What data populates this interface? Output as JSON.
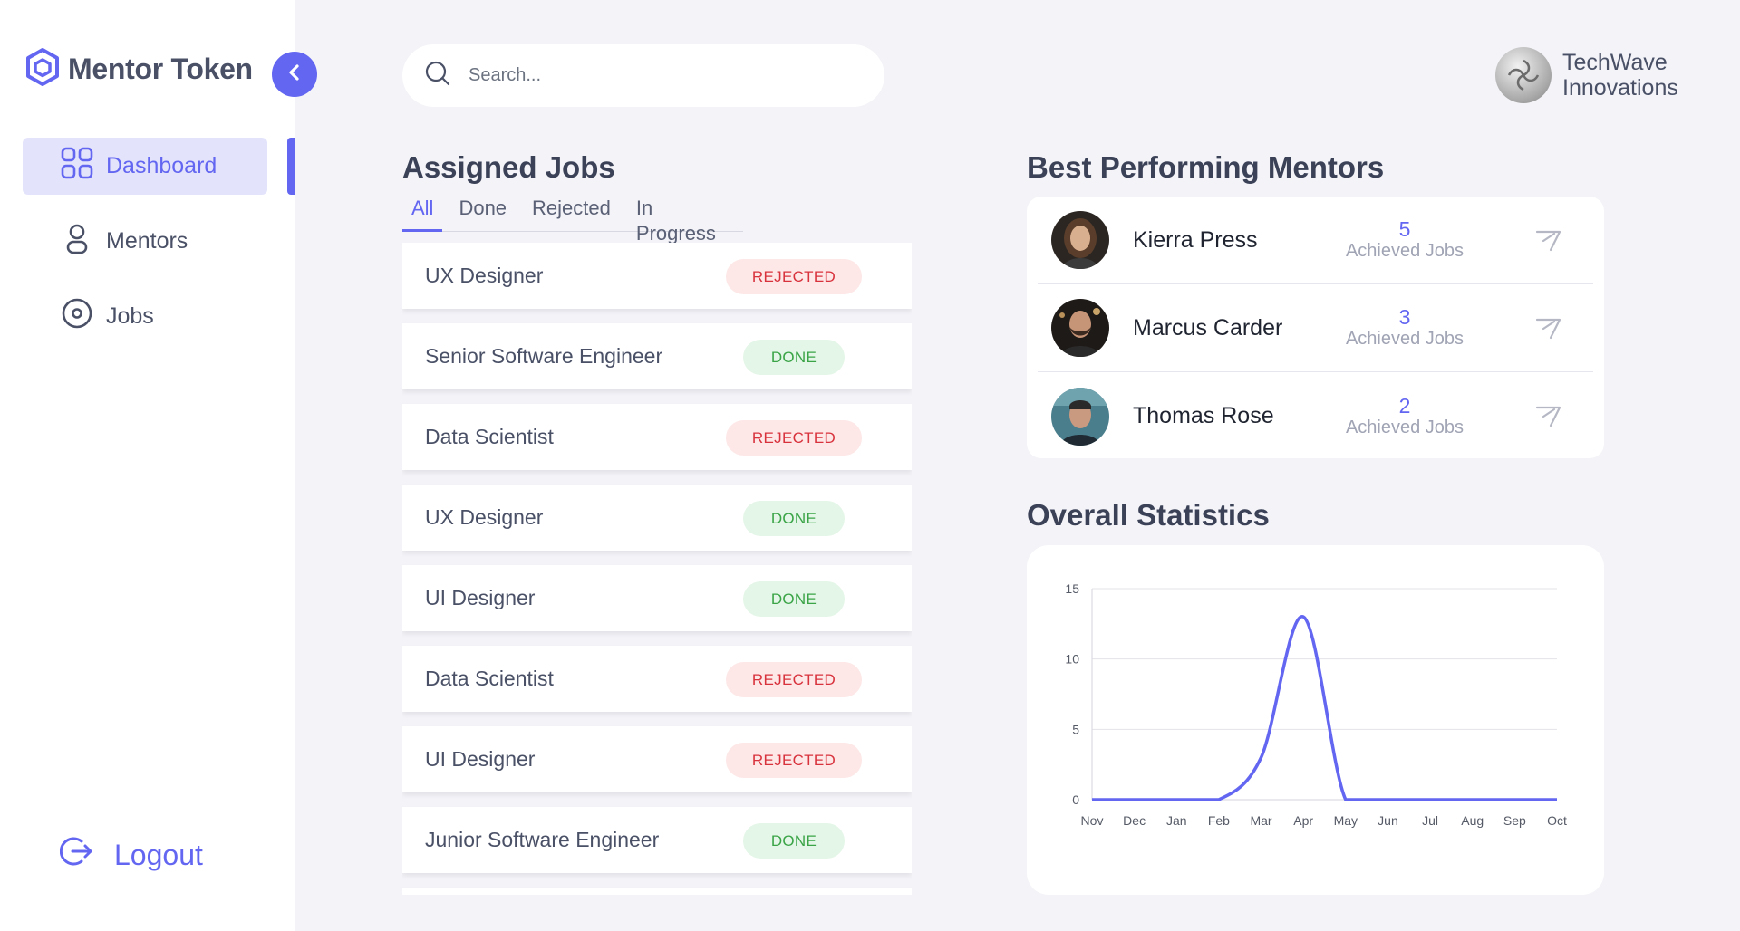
{
  "app": {
    "brand": "Mentor Token",
    "accent": "#6366f1"
  },
  "sidebar": {
    "items": [
      {
        "label": "Dashboard",
        "icon": "grid-icon",
        "active": true
      },
      {
        "label": "Mentors",
        "icon": "user-icon",
        "active": false
      },
      {
        "label": "Jobs",
        "icon": "target-icon",
        "active": false
      }
    ],
    "logout_label": "Logout"
  },
  "search": {
    "placeholder": "Search..."
  },
  "company": {
    "name_line1": "TechWave",
    "name_line2": "Innovations"
  },
  "assigned_jobs": {
    "title": "Assigned Jobs",
    "tabs": [
      "All",
      "Done",
      "Rejected",
      "In Progress"
    ],
    "active_tab": "All",
    "rows": [
      {
        "title": "UX Designer",
        "status": "REJECTED"
      },
      {
        "title": "Senior Software Engineer",
        "status": "DONE"
      },
      {
        "title": "Data Scientist",
        "status": "REJECTED"
      },
      {
        "title": "UX Designer",
        "status": "DONE"
      },
      {
        "title": "UI Designer",
        "status": "DONE"
      },
      {
        "title": "Data Scientist",
        "status": "REJECTED"
      },
      {
        "title": "UI Designer",
        "status": "REJECTED"
      },
      {
        "title": "Junior Software Engineer",
        "status": "DONE"
      }
    ]
  },
  "mentors": {
    "title": "Best Performing Mentors",
    "rows": [
      {
        "name": "Kierra Press",
        "count": "5",
        "caption": "Achieved Jobs"
      },
      {
        "name": "Marcus Carder",
        "count": "3",
        "caption": "Achieved Jobs"
      },
      {
        "name": "Thomas Rose",
        "count": "2",
        "caption": "Achieved Jobs"
      }
    ]
  },
  "statistics": {
    "title": "Overall Statistics"
  },
  "chart_data": {
    "type": "line",
    "categories": [
      "Nov",
      "Dec",
      "Jan",
      "Feb",
      "Mar",
      "Apr",
      "May",
      "Jun",
      "Jul",
      "Aug",
      "Sep",
      "Oct"
    ],
    "series": [
      {
        "values": [
          0,
          0,
          0,
          0,
          3,
          13,
          0,
          0,
          0,
          0,
          0,
          0
        ],
        "color": "#6366f1"
      }
    ],
    "ylim": [
      0,
      15
    ],
    "yticks": [
      0,
      5,
      10,
      15
    ],
    "grid": true,
    "legend": "none"
  }
}
